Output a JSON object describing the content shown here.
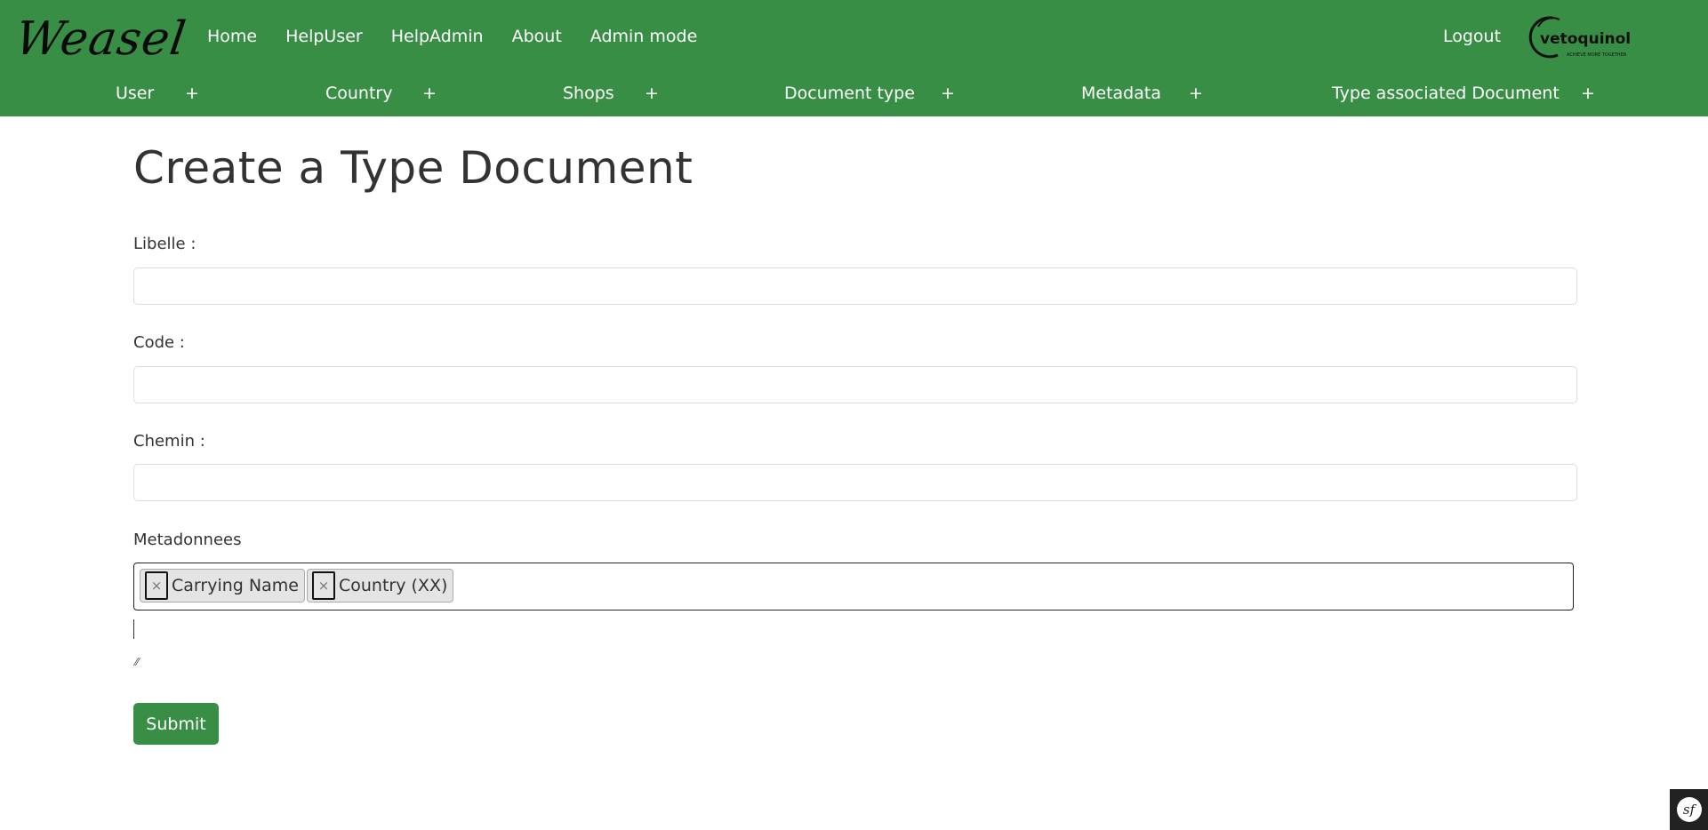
{
  "brand": "Weasel",
  "topnav": [
    "Home",
    "HelpUser",
    "HelpAdmin",
    "About",
    "Admin mode"
  ],
  "logout": "Logout",
  "logo": {
    "name": "vetoquinol",
    "tagline": "ACHIEVE MORE TOGETHER"
  },
  "subnav": [
    {
      "label": "User",
      "plus": "+"
    },
    {
      "label": "Country",
      "plus": "+"
    },
    {
      "label": "Shops",
      "plus": "+"
    },
    {
      "label": "Document type",
      "plus": "+"
    },
    {
      "label": "Metadata",
      "plus": "+"
    },
    {
      "label": "Type associated Document",
      "plus": "+"
    }
  ],
  "form": {
    "title": "Create a Type Document",
    "libelle_label": "Libelle :",
    "libelle_value": "",
    "code_label": "Code :",
    "code_value": "",
    "chemin_label": "Chemin :",
    "chemin_value": "",
    "metadonnees_label": "Metadonnees",
    "tags": [
      {
        "remove": "×",
        "label": "Carrying Name"
      },
      {
        "remove": "×",
        "label": "Country (XX)"
      }
    ],
    "submit": "Submit"
  },
  "colors": {
    "header": "#388e44",
    "button": "#388e44"
  },
  "icons": {
    "debug_toolbar": "symfony-icon",
    "resize": "resize-handle-icon"
  },
  "debug_badge": "sf"
}
